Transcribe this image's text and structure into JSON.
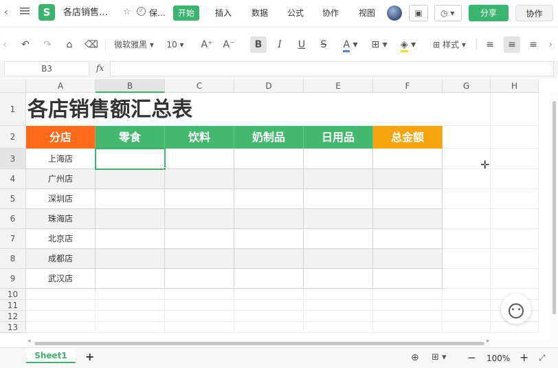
{
  "topbar": {
    "doc_title": "各店销售…",
    "save_label": "保…",
    "menu": [
      "开始",
      "插入",
      "数据",
      "公式",
      "协作",
      "视图"
    ],
    "share_label": "分享",
    "collab_label": "协作"
  },
  "toolbar": {
    "font_name": "微软雅黑",
    "font_size": "10",
    "style_label": "样式"
  },
  "formula": {
    "cell_ref": "B3",
    "fx_label": "fx",
    "value": ""
  },
  "sheet": {
    "columns": [
      "A",
      "B",
      "C",
      "D",
      "E",
      "F",
      "G",
      "H"
    ],
    "rows": [
      "1",
      "2",
      "3",
      "4",
      "5",
      "6",
      "7",
      "8",
      "9",
      "10",
      "11",
      "12",
      "13"
    ],
    "title": "各店销售额汇总表",
    "headers": [
      "分店",
      "零食",
      "饮料",
      "奶制品",
      "日用品",
      "总金额"
    ],
    "stores": [
      "上海店",
      "广州店",
      "深圳店",
      "珠海店",
      "北京店",
      "成都店",
      "武汉店"
    ],
    "colors": {
      "orange": "#ff6b1a",
      "green": "#43b86f",
      "gold": "#f5a40b",
      "stripe": "#f2f2f2"
    }
  },
  "status": {
    "sheet_tab": "Sheet1",
    "add_tab": "+",
    "zoom": "100%",
    "zoom_out": "−",
    "zoom_in": "+"
  }
}
